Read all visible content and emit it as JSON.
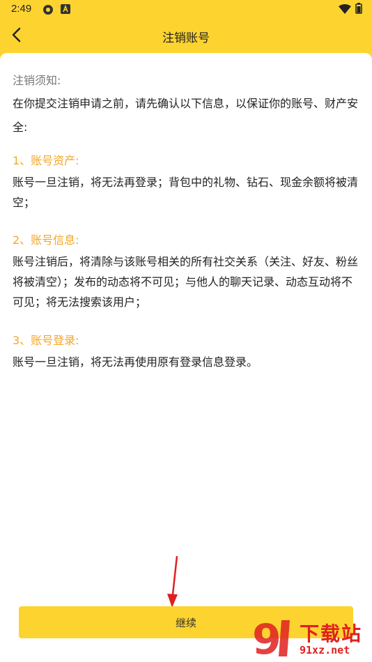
{
  "status_bar": {
    "time": "2:49"
  },
  "nav": {
    "title": "注销账号"
  },
  "notice": {
    "title": "注销须知:",
    "intro": "在你提交注销申请之前，请先确认以下信息，以保证你的账号、财产安全:"
  },
  "sections": [
    {
      "title": "1、账号资产:",
      "body": "账号一旦注销，将无法再登录；背包中的礼物、钻石、现金余额将被清空；"
    },
    {
      "title": "2、账号信息:",
      "body": "账号注销后，将清除与该账号相关的所有社交关系（关注、好友、粉丝将被清空）；发布的动态将不可见；与他人的聊天记录、动态互动将不可见；将无法搜索该用户；"
    },
    {
      "title": "3、账号登录:",
      "body": "账号一旦注销，将无法再使用原有登录信息登录。"
    }
  ],
  "actions": {
    "continue_label": "继续"
  },
  "watermark": {
    "brand_text": "下载站",
    "url": "91xz.net"
  },
  "colors": {
    "accent_yellow": "#fdd330",
    "section_title": "#f5a623",
    "watermark_red": "#e02020"
  }
}
